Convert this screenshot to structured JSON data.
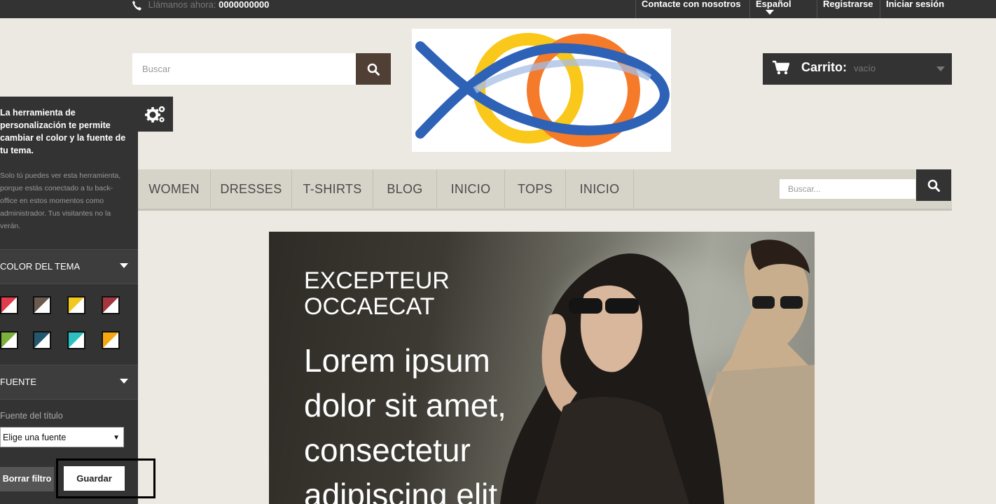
{
  "topbar": {
    "phone_label": "Llámanos ahora:",
    "phone_number": "0000000000",
    "contact": "Contacte con nosotros",
    "language": "Español",
    "register": "Registrarse",
    "login": "Iniciar sesión"
  },
  "header": {
    "search_placeholder": "Buscar",
    "cart_label": "Carrito:",
    "cart_state": "vacío"
  },
  "nav": {
    "items": [
      "WOMEN",
      "DRESSES",
      "T-SHIRTS",
      "BLOG",
      "INICIO",
      "TOPS",
      "INICIO"
    ],
    "search_placeholder": "Buscar..."
  },
  "banner": {
    "kicker_line1": "EXCEPTEUR",
    "kicker_line2": "OCCAECAT",
    "headline": [
      "Lorem ipsum",
      "dolor sit amet,",
      "consectetur",
      "adipiscing elit"
    ]
  },
  "panel": {
    "intro": "La herramienta de personalización te permite cambiar el color y la fuente de tu tema.",
    "note": "Solo tú puedes ver esta herramienta, porque estás conectado a tu back-office en estos momentos como administrador. Tus visitantes no la verán.",
    "color_section": "COLOR DEL TEMA",
    "font_section": "FUENTE",
    "font_label": "Fuente del título",
    "font_select_value": "Elige una fuente",
    "reset_button": "Borrar filtro",
    "save_button": "Guardar"
  },
  "colors": {
    "topbar": "#333333",
    "search_button": "#4f3f34",
    "page_background": "#ebe9e2",
    "nav_background": "#d6d4c9",
    "panel_background": "#333333"
  },
  "swatches": [
    {
      "a": "#e03c4c",
      "b": "#ffffff"
    },
    {
      "a": "#6b5a4e",
      "b": "#ffffff"
    },
    {
      "a": "#f2c81e",
      "b": "#ffffff"
    },
    {
      "a": "#a4373e",
      "b": "#ffffff"
    },
    {
      "a": "#7ab03b",
      "b": "#ffffff"
    },
    {
      "a": "#23576d",
      "b": "#ffffff"
    },
    {
      "a": "#2bbfc2",
      "b": "#ffffff"
    },
    {
      "a": "#f5a611",
      "b": "#ffffff"
    }
  ],
  "icons": {
    "phone": "phone-icon",
    "language_caret": "chevron-down-icon",
    "search": "search-icon",
    "cart": "cart-icon",
    "gear": "gear-icon"
  }
}
